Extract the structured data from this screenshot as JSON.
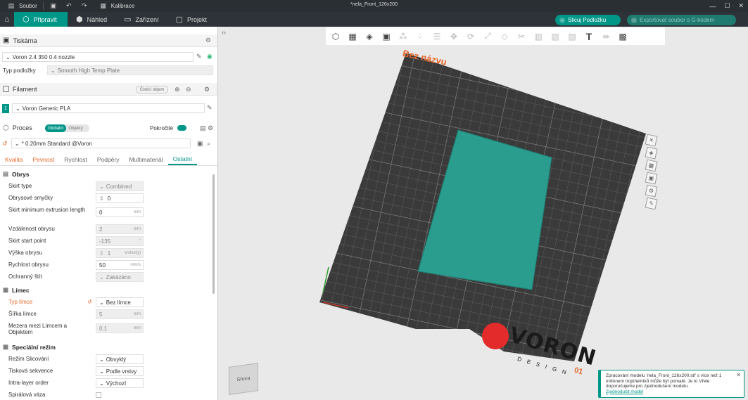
{
  "window": {
    "file_menu": "Soubor",
    "calibration": "Kalibrace",
    "doc_title": "*nela_Front_126x200"
  },
  "topbar": {
    "tabs": [
      {
        "label": "Připravit"
      },
      {
        "label": "Náhled"
      },
      {
        "label": "Zařízení"
      },
      {
        "label": "Projekt"
      }
    ],
    "slice_button": "Slicuj Podložku",
    "export_button": "Exportovat soubor s G-kódem"
  },
  "printer": {
    "section_title": "Tiskárna",
    "printer_name": "Voron 2.4 350 0.4 nozzle",
    "plate_label": "Typ podložky",
    "plate_value": "Smooth High Temp Plate"
  },
  "filament": {
    "section_title": "Filament",
    "clean_button": "Čistící objem",
    "slot_number": "1",
    "filament_name": "Voron Generic PLA"
  },
  "process": {
    "section_title": "Proces",
    "toggle_global": "Globální",
    "toggle_objects": "Objekty",
    "advanced_label": "Pokročilé",
    "profile_name": "* 0.20mm Standard @Voron"
  },
  "settings_tabs": [
    {
      "label": "Kvalita"
    },
    {
      "label": "Pevnost"
    },
    {
      "label": "Rychlost"
    },
    {
      "label": "Podpěry"
    },
    {
      "label": "Multimateriál"
    },
    {
      "label": "Ostatní"
    }
  ],
  "skirt": {
    "title": "Obrys",
    "rows": [
      {
        "name": "Skirt type",
        "value": "Combined",
        "unit": ""
      },
      {
        "name": "Obrysové smyčky",
        "value": "0",
        "unit": ""
      },
      {
        "name": "Skirt minimum extrusion length",
        "value": "0",
        "unit": "mm"
      },
      {
        "name": "Vzdálenost obrysu",
        "value": "2",
        "unit": "mm"
      },
      {
        "name": "Skirt start point",
        "value": "-135",
        "unit": "°"
      },
      {
        "name": "Výška obrysu",
        "value": "1",
        "unit": "vrstev(y)"
      },
      {
        "name": "Rychlost obrysu",
        "value": "50",
        "unit": "mm/s"
      },
      {
        "name": "Ochranný štít",
        "value": "Zakázáno",
        "unit": ""
      }
    ]
  },
  "brim": {
    "title": "Límec",
    "rows": [
      {
        "name": "Typ límce",
        "value": "Bez límce",
        "unit": ""
      },
      {
        "name": "Šířka límce",
        "value": "5",
        "unit": "mm"
      },
      {
        "name": "Mezera mezi Límcem a Objektem",
        "value": "0,1",
        "unit": "mm"
      }
    ]
  },
  "special": {
    "title": "Speciální režim",
    "rows": [
      {
        "name": "Režim Slicování",
        "value": "Obvyklý"
      },
      {
        "name": "Tisková sekvence",
        "value": "Podle vrstvy"
      },
      {
        "name": "Intra-layer order",
        "value": "Výchozí"
      },
      {
        "name": "Spirálová váza",
        "value": ""
      }
    ]
  },
  "viewport": {
    "plate_name": "Bez názvu",
    "brand": "VORON",
    "brand_sub": "D E S I G N",
    "plate_number": "01",
    "viewcube_label": "Shora"
  },
  "notification": {
    "text": "Zpracování modelu 'nela_Front_126x200.stl' s více než 1 milionem trojúhelníků může být pomalé. Je to Vřele doporučujeme pro zjednodušení modelu.",
    "link": "Zjednodušit model"
  },
  "colors": {
    "accent": "#009688",
    "orange": "#e96a2c",
    "bed": "#3d3d3d",
    "model": "#2a9d8f"
  }
}
